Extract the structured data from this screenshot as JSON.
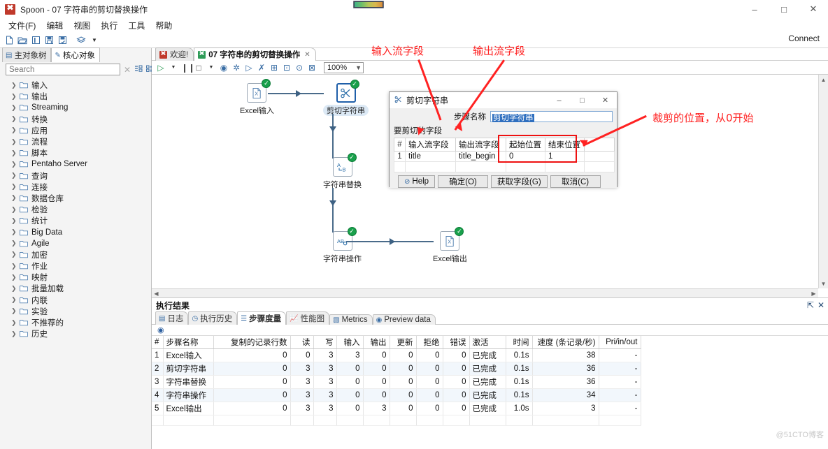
{
  "window": {
    "title": "Spoon - 07 字符串的剪切替换操作",
    "app_icon": "spoon-icon",
    "minimize": "–",
    "maximize": "□",
    "close": "✕"
  },
  "menubar": [
    "文件(F)",
    "编辑",
    "视图",
    "执行",
    "工具",
    "帮助"
  ],
  "main_toolbar": {
    "buttons": [
      "new-file-icon",
      "open-file-icon",
      "explorer-icon",
      "save-icon",
      "save-as-icon",
      "layers-icon",
      "dropdown-caret-icon"
    ],
    "connect_label": "Connect"
  },
  "sidebar": {
    "tabs": [
      {
        "label": "主对象树",
        "icon": "tree-icon",
        "active": false
      },
      {
        "label": "核心对象",
        "icon": "pencil-icon",
        "active": true
      }
    ],
    "search": {
      "placeholder": "Search",
      "value": "",
      "clear_icon": "close-icon"
    },
    "tool_icons": [
      "collapse-all-icon",
      "expand-all-icon"
    ],
    "items": [
      "输入",
      "输出",
      "Streaming",
      "转换",
      "应用",
      "流程",
      "脚本",
      "Pentaho Server",
      "查询",
      "连接",
      "数据仓库",
      "检验",
      "统计",
      "Big Data",
      "Agile",
      "加密",
      "作业",
      "映射",
      "批量加载",
      "内联",
      "实验",
      "不推荐的",
      "历史"
    ]
  },
  "editor": {
    "tabs": [
      {
        "label": "欢迎!",
        "icon": "spoon-icon",
        "active": false,
        "closable": false
      },
      {
        "label": "07 字符串的剪切替换操作",
        "icon": "transformation-icon",
        "active": true,
        "closable": true
      }
    ],
    "toolbar_icons": [
      "run-icon",
      "run-dropdown-icon",
      "pause-icon",
      "stop-icon",
      "stop-dropdown-icon",
      "preview-icon",
      "debug-icon",
      "replay-icon",
      "verify-icon",
      "impact-icon",
      "sql-icon",
      "inspect-icon",
      "fit-to-screen-icon"
    ],
    "zoom": {
      "value": "100%",
      "caret": "chevron-down-icon"
    },
    "steps": [
      {
        "name": "Excel输入",
        "icon": "excel-input-icon",
        "status": "ok",
        "selected": false
      },
      {
        "name": "剪切字符串",
        "icon": "scissors-icon",
        "status": "ok",
        "selected": true
      },
      {
        "name": "字符串替换",
        "icon": "string-replace-icon",
        "status": "ok",
        "selected": false
      },
      {
        "name": "字符串操作",
        "icon": "string-operations-icon",
        "status": "ok",
        "selected": false
      },
      {
        "name": "Excel输出",
        "icon": "excel-output-icon",
        "status": "ok",
        "selected": false
      }
    ]
  },
  "annotations": [
    {
      "id": "input-stream-field",
      "text": "输入流字段"
    },
    {
      "id": "output-stream-field",
      "text": "输出流字段"
    },
    {
      "id": "cut-position",
      "text": "裁剪的位置，从0开始"
    }
  ],
  "dialog": {
    "title": "剪切字符串",
    "title_icon": "scissors-icon",
    "controls": {
      "minimize": "–",
      "maximize": "□",
      "close": "✕"
    },
    "step_name_label": "步骤名称",
    "step_name_value": "剪切字符串",
    "section_label": "要剪切的字段",
    "grid": {
      "headers": [
        "#",
        "输入流字段",
        "输出流字段",
        "起始位置",
        "结束位置",
        ""
      ],
      "rows": [
        [
          "1",
          "title",
          "title_begin",
          "0",
          "1",
          ""
        ]
      ]
    },
    "buttons": [
      {
        "label": "Help",
        "icon": "help-icon"
      },
      {
        "label": "确定(O)",
        "icon": ""
      },
      {
        "label": "获取字段(G)",
        "icon": ""
      },
      {
        "label": "取消(C)",
        "icon": ""
      }
    ]
  },
  "results": {
    "title": "执行结果",
    "actions": [
      "maximize-panel-icon",
      "close-panel-icon"
    ],
    "tabs": [
      {
        "label": "日志",
        "icon": "log-icon",
        "active": false
      },
      {
        "label": "执行历史",
        "icon": "history-icon",
        "active": false
      },
      {
        "label": "步骤度量",
        "icon": "metrics-list-icon",
        "active": true
      },
      {
        "label": "性能图",
        "icon": "chart-icon",
        "active": false
      },
      {
        "label": "Metrics",
        "icon": "metrics-icon",
        "active": false
      },
      {
        "label": "Preview data",
        "icon": "preview-icon",
        "active": false
      }
    ],
    "subtoolbar_icon": "eye-icon",
    "table": {
      "headers": [
        "#",
        "步骤名称",
        "复制的记录行数",
        "读",
        "写",
        "输入",
        "输出",
        "更新",
        "拒绝",
        "错误",
        "激活",
        "时间",
        "速度 (条记录/秒)",
        "Pri/in/out"
      ],
      "rows": [
        [
          "1",
          "Excel输入",
          "0",
          "0",
          "3",
          "3",
          "0",
          "0",
          "0",
          "0",
          "已完成",
          "0.1s",
          "38",
          "-"
        ],
        [
          "2",
          "剪切字符串",
          "0",
          "3",
          "3",
          "0",
          "0",
          "0",
          "0",
          "0",
          "已完成",
          "0.1s",
          "36",
          "-"
        ],
        [
          "3",
          "字符串替换",
          "0",
          "3",
          "3",
          "0",
          "0",
          "0",
          "0",
          "0",
          "已完成",
          "0.1s",
          "36",
          "-"
        ],
        [
          "4",
          "字符串操作",
          "0",
          "3",
          "3",
          "0",
          "0",
          "0",
          "0",
          "0",
          "已完成",
          "0.1s",
          "34",
          "-"
        ],
        [
          "5",
          "Excel输出",
          "0",
          "3",
          "3",
          "0",
          "3",
          "0",
          "0",
          "0",
          "已完成",
          "1.0s",
          "3",
          "-"
        ]
      ]
    }
  },
  "watermark": "@51CTO博客",
  "colors": {
    "accent": "#3a6ea5",
    "annotation_red": "#ff2222",
    "status_green": "#19a04b",
    "selection_blue": "#2f6fbf"
  }
}
